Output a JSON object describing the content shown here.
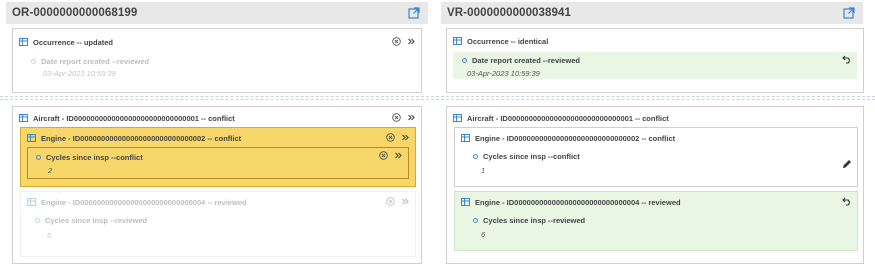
{
  "left": {
    "title": "OR-0000000000068199",
    "occurrence": {
      "header": "Occurrence -- updated",
      "field_label": "Date report created --reviewed",
      "field_value": "03-Apr-2023 10:59:39"
    },
    "aircraft": {
      "header": "Aircraft - ID000000000000000000000000000001 -- conflict",
      "engine1": {
        "header": "Engine - ID000000000000000000000000000002 -- conflict",
        "field_label": "Cycles since insp --conflict",
        "field_value": "2"
      },
      "engine2": {
        "header": "Engine - ID000000000000000000000000000004 -- reviewed",
        "field_label": "Cycles since insp --reviewed",
        "field_value": "6"
      }
    }
  },
  "right": {
    "title": "VR-0000000000038941",
    "occurrence": {
      "header": "Occurrence -- identical",
      "field_label": "Date report created --reviewed",
      "field_value": "03-Apr-2023 10:59:39"
    },
    "aircraft": {
      "header": "Aircraft - ID000000000000000000000000000001 -- conflict",
      "engine1": {
        "header": "Engine - ID000000000000000000000000000002 -- conflict",
        "field_label": "Cycles since insp --conflict",
        "field_value": "1"
      },
      "engine2": {
        "header": "Engine - ID000000000000000000000000000004 -- reviewed",
        "field_label": "Cycles since insp --reviewed",
        "field_value": "6"
      }
    }
  },
  "icons": {
    "external_link": "external-link-icon",
    "grid": "grid-icon",
    "clear": "clear-circle-icon",
    "expand": "double-chevron-right-icon",
    "undo": "undo-icon",
    "edit": "pencil-icon"
  },
  "colors": {
    "conflict_highlight": "#f7d76a",
    "conflict_border": "#d9a92e",
    "reviewed_bg": "#eaf6e4",
    "accent_blue": "#3a86d1"
  }
}
